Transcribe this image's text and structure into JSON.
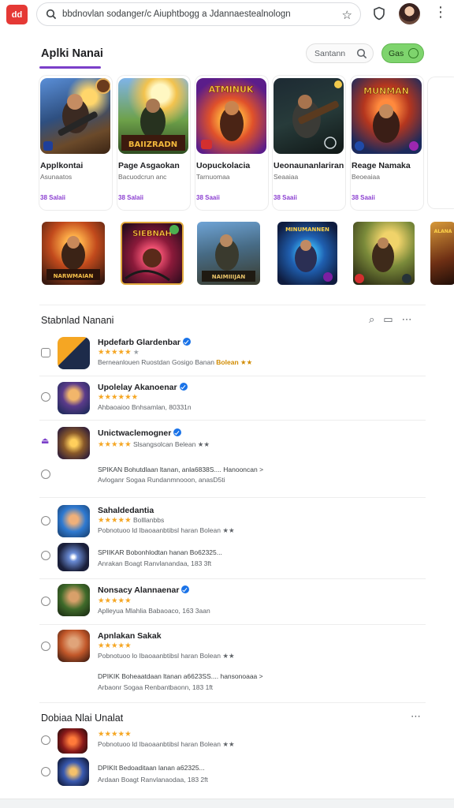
{
  "browser": {
    "app_logo": "dd",
    "url": "bbdnovlan sodanger/c Aiuphtbogg a Jdannaestealnologn",
    "icons": [
      "search-icon",
      "star-icon",
      "shield-icon",
      "avatar",
      "more-vert-icon"
    ]
  },
  "section": {
    "title": "Aplki Nanai",
    "filter_label": "Santann",
    "go_label": "Gas"
  },
  "cards": [
    {
      "name": "Applkontai",
      "sub": "Asunaatos",
      "price": "38 Salaii",
      "art_text": ""
    },
    {
      "name": "Page Asgaokan",
      "sub": "Bacuodcrun anc",
      "price": "38 Salaii",
      "art_text": "BAIIZRADN"
    },
    {
      "name": "Uopuckolacia",
      "sub": "Tarnuomaa",
      "price": "38 Saaii",
      "art_text": "ATMINUK"
    },
    {
      "name": "Ueonaunanlariran",
      "sub": "Seaaiaa",
      "price": "38 Saaii",
      "art_text": ""
    },
    {
      "name": "Reage Namaka",
      "sub": "Beoeaiaa",
      "price": "38 Saaii",
      "art_text": "MUNMAN"
    }
  ],
  "thumbs": [
    "NARWMAIAN",
    "SIEBNAH",
    "NAIMIIIJAN",
    "MINUMANNEN",
    "",
    "ALANA"
  ],
  "list": {
    "heading": "Stabnlad Nanani",
    "items": [
      {
        "title": "Hpdefarb Glardenbar",
        "meta": "Berneanlouen Ruostdan Gosigo Banan",
        "badge": "Bolean ★★",
        "sub": "",
        "sub2": ""
      },
      {
        "title": "Upolelay Akanoenar",
        "meta": "Ahbaoaioo Bnhsamlan, 80331n",
        "badge": "",
        "sub": "",
        "sub2": ""
      },
      {
        "title": "Unictwaclemogner",
        "meta": "Slsangsolcan Belean ★★",
        "badge": "",
        "sub": "SPIKAN Bohutdlaan ltanan, anla6838S.... Hanooncan >",
        "sub2": "Avloganr Sogaa Rundanmnooon, anasD5ti"
      },
      {
        "title": "Sahaldedantia",
        "meta": "Bolllanbbs",
        "badge": "",
        "sub": "Pobnotuoo ld Ibaoaanbtibsl haran Bolean ★★",
        "sub2": ""
      },
      {
        "title": "",
        "meta": "",
        "badge": "",
        "sub": "SPIIKAR Bobonhlodtan hanan Bo62325...",
        "sub2": "Anrakan Boagt Ranvlanandaa, 183 3ft"
      },
      {
        "title": "Nonsacy Alannaenar",
        "meta": "Aplleyua Mlahlia Babaoaco, 163 3aan",
        "badge": "",
        "sub": "",
        "sub2": ""
      },
      {
        "title": "Apnlakan Sakak",
        "meta": "Pobnotuoo lo Ibaoaanbtibsl haran Bolean ★★",
        "badge": "",
        "sub": "DPIKIK Boheaatdaan ltanan a6623SS.... hansonoaaa >",
        "sub2": "Arbaonr Sogaa Renbantbaonn, 183 1ft"
      }
    ]
  },
  "bottom": {
    "heading": "Dobiaa Nlai Unalat",
    "items": [
      {
        "meta": "Pobnotuoo ld Ibaoaanbtibsl haran Bolean ★★",
        "sub": ""
      },
      {
        "meta": "DPIKIt Bedoaditaan lanan a62325...",
        "sub": "Ardaan Boagt Ranvlanaodaa, 183 2ft"
      }
    ]
  }
}
